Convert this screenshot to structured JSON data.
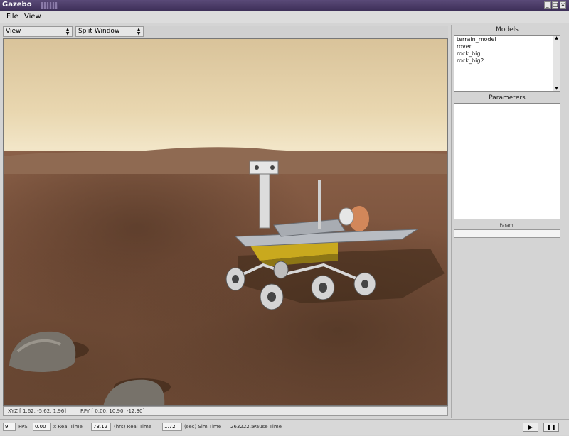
{
  "window": {
    "title": "Gazebo"
  },
  "menu": {
    "file": "File",
    "view": "View"
  },
  "toolbar": {
    "view_combo": "View",
    "split_combo": "Split Window"
  },
  "right_panel": {
    "models_header": "Models",
    "models": [
      "terrain_model",
      "rover",
      "rock_big",
      "rock_big2"
    ],
    "parameters_header": "Parameters",
    "param_label": "Param:"
  },
  "status_top": {
    "xyz": "XYZ [ 1.62, -5.62, 1.96]",
    "rpy": "RPY [ 0.00, 10.90, -12.30]"
  },
  "status_bottom": {
    "fps_value": "9",
    "fps_label": "FPS",
    "realtime_ratio": "0.00",
    "realtime_ratio_label": "x Real Time",
    "real_time": "73.12",
    "real_time_label": "(hrs) Real Time",
    "sim_time": "1.72",
    "sim_time_label": "(sec) Sim Time",
    "pause_time": "263222.5",
    "pause_time_label": "Pause Time"
  },
  "icons": {
    "play": "play-icon",
    "pause": "pause-icon"
  }
}
